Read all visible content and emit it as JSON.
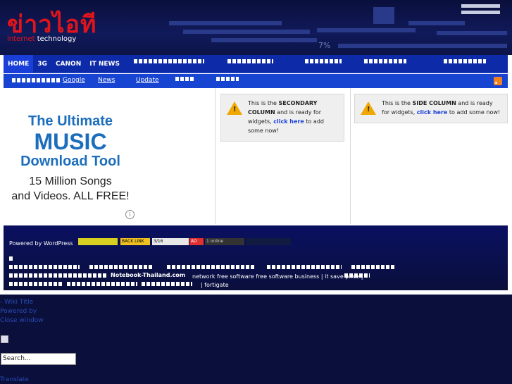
{
  "header": {
    "logo_thai": "ข่าวไอที",
    "logo_sub_red": "internet",
    "logo_sub_white": " technology",
    "percent_text": "7%"
  },
  "nav": {
    "items": [
      "HOME",
      "3G",
      "CANON",
      "IT NEWS"
    ]
  },
  "subnav": {
    "google": "Google",
    "news": "News",
    "update": "Update"
  },
  "ad": {
    "line1": "The Ultimate",
    "line2": "MUSIC",
    "line3": "Download Tool",
    "line4": "15 Million Songs",
    "line5": "and Videos. ALL FREE!"
  },
  "secondary": {
    "pre": "This is the ",
    "bold": "SECONDARY COLUMN",
    "mid": " and is ready for widgets, ",
    "link": "click here",
    "post": " to add some now!"
  },
  "side": {
    "pre": "This is the ",
    "bold": "SIDE COLUMN",
    "mid": " and is ready for widgets, ",
    "link": "click here",
    "post": " to add some now!"
  },
  "footer": {
    "powered": "Powered by WordPress",
    "counter": "3/16",
    "online": "1 online",
    "notebook": "Notebook-Thailand.com",
    "keywords": "network free software free software business | it save price |",
    "fortigate": "| fortigate"
  },
  "bottom": {
    "wiki": "- Wiki Title",
    "powered": "Powered by",
    "close": "Close window",
    "search_placeholder": "Search...",
    "translate": "Translate"
  },
  "colors": {
    "header_bg": "#0a0f3c",
    "nav_bg": "#0d2aa8",
    "logo_red": "#e0141a",
    "ad_blue": "#1c6ebc"
  }
}
